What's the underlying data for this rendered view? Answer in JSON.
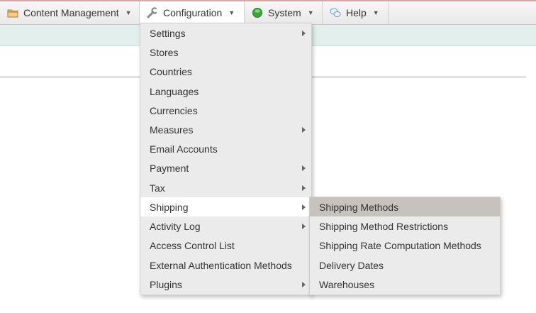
{
  "menubar": {
    "items": [
      {
        "label": "Content Management",
        "icon": "folder-icon"
      },
      {
        "label": "Configuration",
        "icon": "wrench-icon"
      },
      {
        "label": "System",
        "icon": "green-status-icon"
      },
      {
        "label": "Help",
        "icon": "chat-bubbles-icon"
      }
    ]
  },
  "configuration_menu": {
    "items": [
      {
        "label": "Settings",
        "has_submenu": true
      },
      {
        "label": "Stores",
        "has_submenu": false
      },
      {
        "label": "Countries",
        "has_submenu": false
      },
      {
        "label": "Languages",
        "has_submenu": false
      },
      {
        "label": "Currencies",
        "has_submenu": false
      },
      {
        "label": "Measures",
        "has_submenu": true
      },
      {
        "label": "Email Accounts",
        "has_submenu": false
      },
      {
        "label": "Payment",
        "has_submenu": true
      },
      {
        "label": "Tax",
        "has_submenu": true
      },
      {
        "label": "Shipping",
        "has_submenu": true
      },
      {
        "label": "Activity Log",
        "has_submenu": true
      },
      {
        "label": "Access Control List",
        "has_submenu": false
      },
      {
        "label": "External Authentication Methods",
        "has_submenu": false
      },
      {
        "label": "Plugins",
        "has_submenu": true
      }
    ],
    "highlighted": "Shipping"
  },
  "shipping_submenu": {
    "items": [
      {
        "label": "Shipping Methods"
      },
      {
        "label": "Shipping Method Restrictions"
      },
      {
        "label": "Shipping Rate Computation Methods"
      },
      {
        "label": "Delivery Dates"
      },
      {
        "label": "Warehouses"
      }
    ],
    "hovered": "Shipping Methods"
  },
  "colors": {
    "menubar_bg": "#ededed",
    "subheader_bg": "#e2efec",
    "dropdown_bg": "#ebebeb",
    "highlight_bg": "#ffffff",
    "hover_bg": "#c6c2be",
    "system_status": "#3aa63a"
  }
}
